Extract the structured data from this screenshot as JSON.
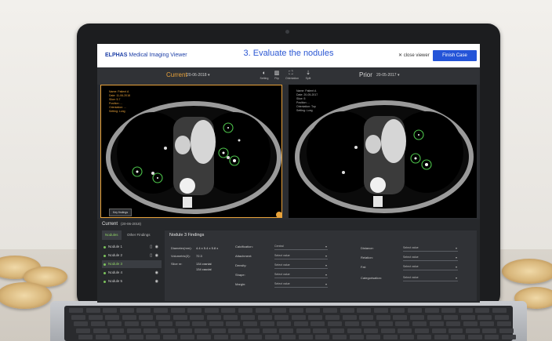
{
  "header": {
    "brand_strong": "ELPHAS",
    "brand_rest": "Medical Imaging Viewer",
    "step_title": "3. Evaluate the nodules",
    "close_label": "close viewer",
    "finish_label": "Finish Case"
  },
  "toolbar": {
    "current_label": "Current",
    "current_date": "20-06-2018",
    "prior_label": "Prior",
    "prior_date": "20-05-2017",
    "tools": [
      {
        "label": "Setting",
        "icon": "contrast-icon"
      },
      {
        "label": "Flip",
        "icon": "flip-icon"
      },
      {
        "label": "Orientation",
        "icon": "orientation-icon"
      },
      {
        "label": "Split",
        "icon": "split-icon"
      }
    ]
  },
  "viewer_current": {
    "overlay": [
      "Name: Patient A",
      "Date: 11-06-2018",
      "Slice: 5.7",
      "Position: ...",
      "Orientation: ...",
      "Setting: Lung"
    ],
    "key_findings": "Key findings"
  },
  "viewer_prior": {
    "overlay": [
      "Name: Patient A",
      "Date: 20-05-2017",
      "Slice: 5",
      "Position: ...",
      "Orientation: Top",
      "Setting: Lung"
    ]
  },
  "panel": {
    "title": "Current",
    "date": "(20-06-2018)",
    "tabs": [
      "Nodules",
      "Other Findings"
    ],
    "nodules": [
      "Nodule 1",
      "Nodule 2",
      "Nodule 3",
      "Nodule 4",
      "Nodule 5"
    ],
    "findings_title": "Nodule 3 Findings",
    "diameter_label": "Diameter(mm):",
    "diameter_value": "4.4 x 5.4 x 5.8 x",
    "volume_label": "Volumetric(3):",
    "volume_value": "72.3",
    "slice_label": "Slice nr:",
    "slice_value_1": "134 cranial",
    "slice_value_2": "134 caudal",
    "fields_mid": [
      {
        "label": "Calcification:",
        "value": "Central"
      },
      {
        "label": "Attachment:",
        "value": "Select value"
      },
      {
        "label": "Density:",
        "value": "Select value"
      },
      {
        "label": "Shape:",
        "value": "Select value"
      },
      {
        "label": "Margin:",
        "value": "Select value"
      }
    ],
    "fields_right": [
      {
        "label": "Distance:",
        "value": "Select value"
      },
      {
        "label": "Relation:",
        "value": "Select value"
      },
      {
        "label": "Fat:",
        "value": "Select value"
      },
      {
        "label": "Categorisation:",
        "value": "Select value"
      }
    ]
  }
}
